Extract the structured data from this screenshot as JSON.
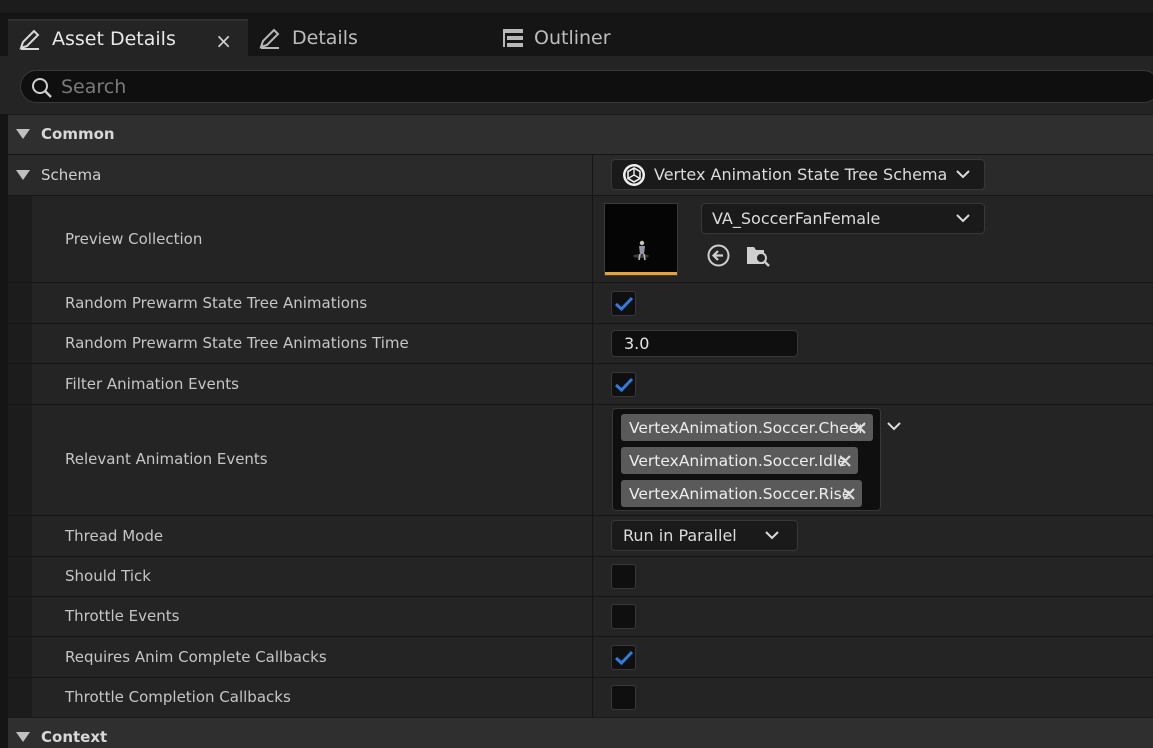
{
  "tabs": [
    {
      "label": "Asset Details",
      "icon": "pencil-icon",
      "active": true,
      "close": "×"
    },
    {
      "label": "Details",
      "icon": "pencil-icon",
      "active": false
    },
    {
      "label": "Outliner",
      "icon": "outliner-list-icon",
      "active": false
    }
  ],
  "search": {
    "placeholder": "Search",
    "value": ""
  },
  "categories": {
    "common": "Common",
    "context": "Context"
  },
  "schema": {
    "label": "Schema",
    "value": "Vertex Animation State Tree Schema",
    "icon": "unreal-logo-icon"
  },
  "properties": {
    "preview_collection": {
      "label": "Preview Collection",
      "value": "VA_SoccerFanFemale"
    },
    "random_prewarm": {
      "label": "Random Prewarm State Tree Animations",
      "checked": true
    },
    "random_prewarm_time": {
      "label": "Random Prewarm State Tree Animations Time",
      "value": "3.0"
    },
    "filter_events": {
      "label": "Filter Animation Events",
      "checked": true
    },
    "relevant_events": {
      "label": "Relevant Animation Events",
      "tags": [
        "VertexAnimation.Soccer.Cheer",
        "VertexAnimation.Soccer.Idle",
        "VertexAnimation.Soccer.Rise"
      ]
    },
    "thread_mode": {
      "label": "Thread Mode",
      "value": "Run in Parallel"
    },
    "should_tick": {
      "label": "Should Tick",
      "checked": false
    },
    "throttle_events": {
      "label": "Throttle Events",
      "checked": false
    },
    "requires_callbacks": {
      "label": "Requires Anim Complete Callbacks",
      "checked": true
    },
    "throttle_completion": {
      "label": "Throttle Completion Callbacks",
      "checked": false
    }
  },
  "colors": {
    "check": "#2f7de1",
    "thumbnail_bar": "#e8a23a",
    "panel_bg": "#242424"
  }
}
